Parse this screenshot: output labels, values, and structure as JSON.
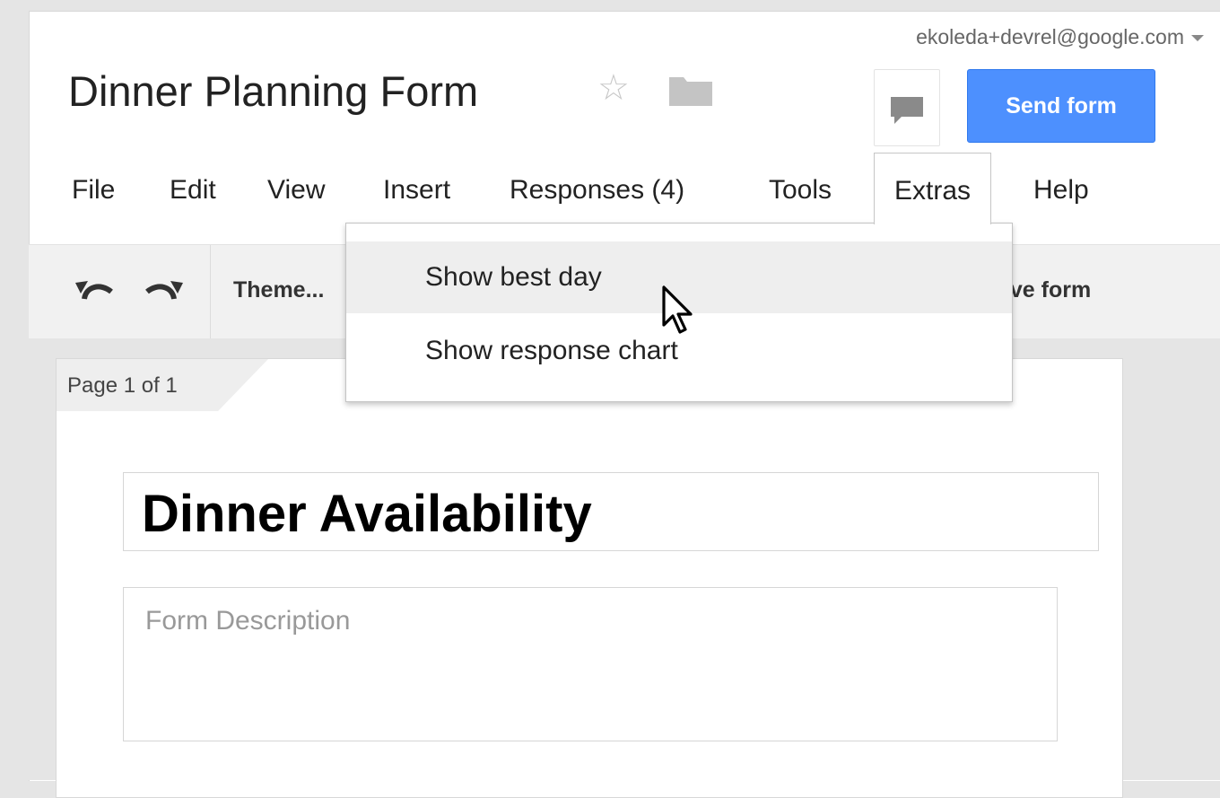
{
  "account": {
    "email": "ekoleda+devrel@google.com"
  },
  "document": {
    "title": "Dinner Planning Form"
  },
  "header": {
    "send_label": "Send form"
  },
  "menus": [
    {
      "label": "File"
    },
    {
      "label": "Edit"
    },
    {
      "label": "View"
    },
    {
      "label": "Insert"
    },
    {
      "label": "Responses (4)"
    },
    {
      "label": "Tools"
    },
    {
      "label": "Extras",
      "open": true
    },
    {
      "label": "Help"
    }
  ],
  "toolbar": {
    "theme_label": "Theme...",
    "live_label": "live form"
  },
  "extras_menu": {
    "items": [
      {
        "label": "Show best day",
        "hovered": true
      },
      {
        "label": "Show response chart"
      }
    ]
  },
  "form": {
    "page_indicator": "Page 1 of 1",
    "title_value": "Dinner Availability",
    "description_placeholder": "Form Description"
  },
  "colors": {
    "send_button": "#4d90fe",
    "menu_hover": "#eeeeee"
  },
  "icons": [
    "star-icon",
    "folder-icon",
    "comment-icon",
    "undo-icon",
    "redo-icon",
    "caret-down-icon",
    "mouse-cursor-icon"
  ]
}
